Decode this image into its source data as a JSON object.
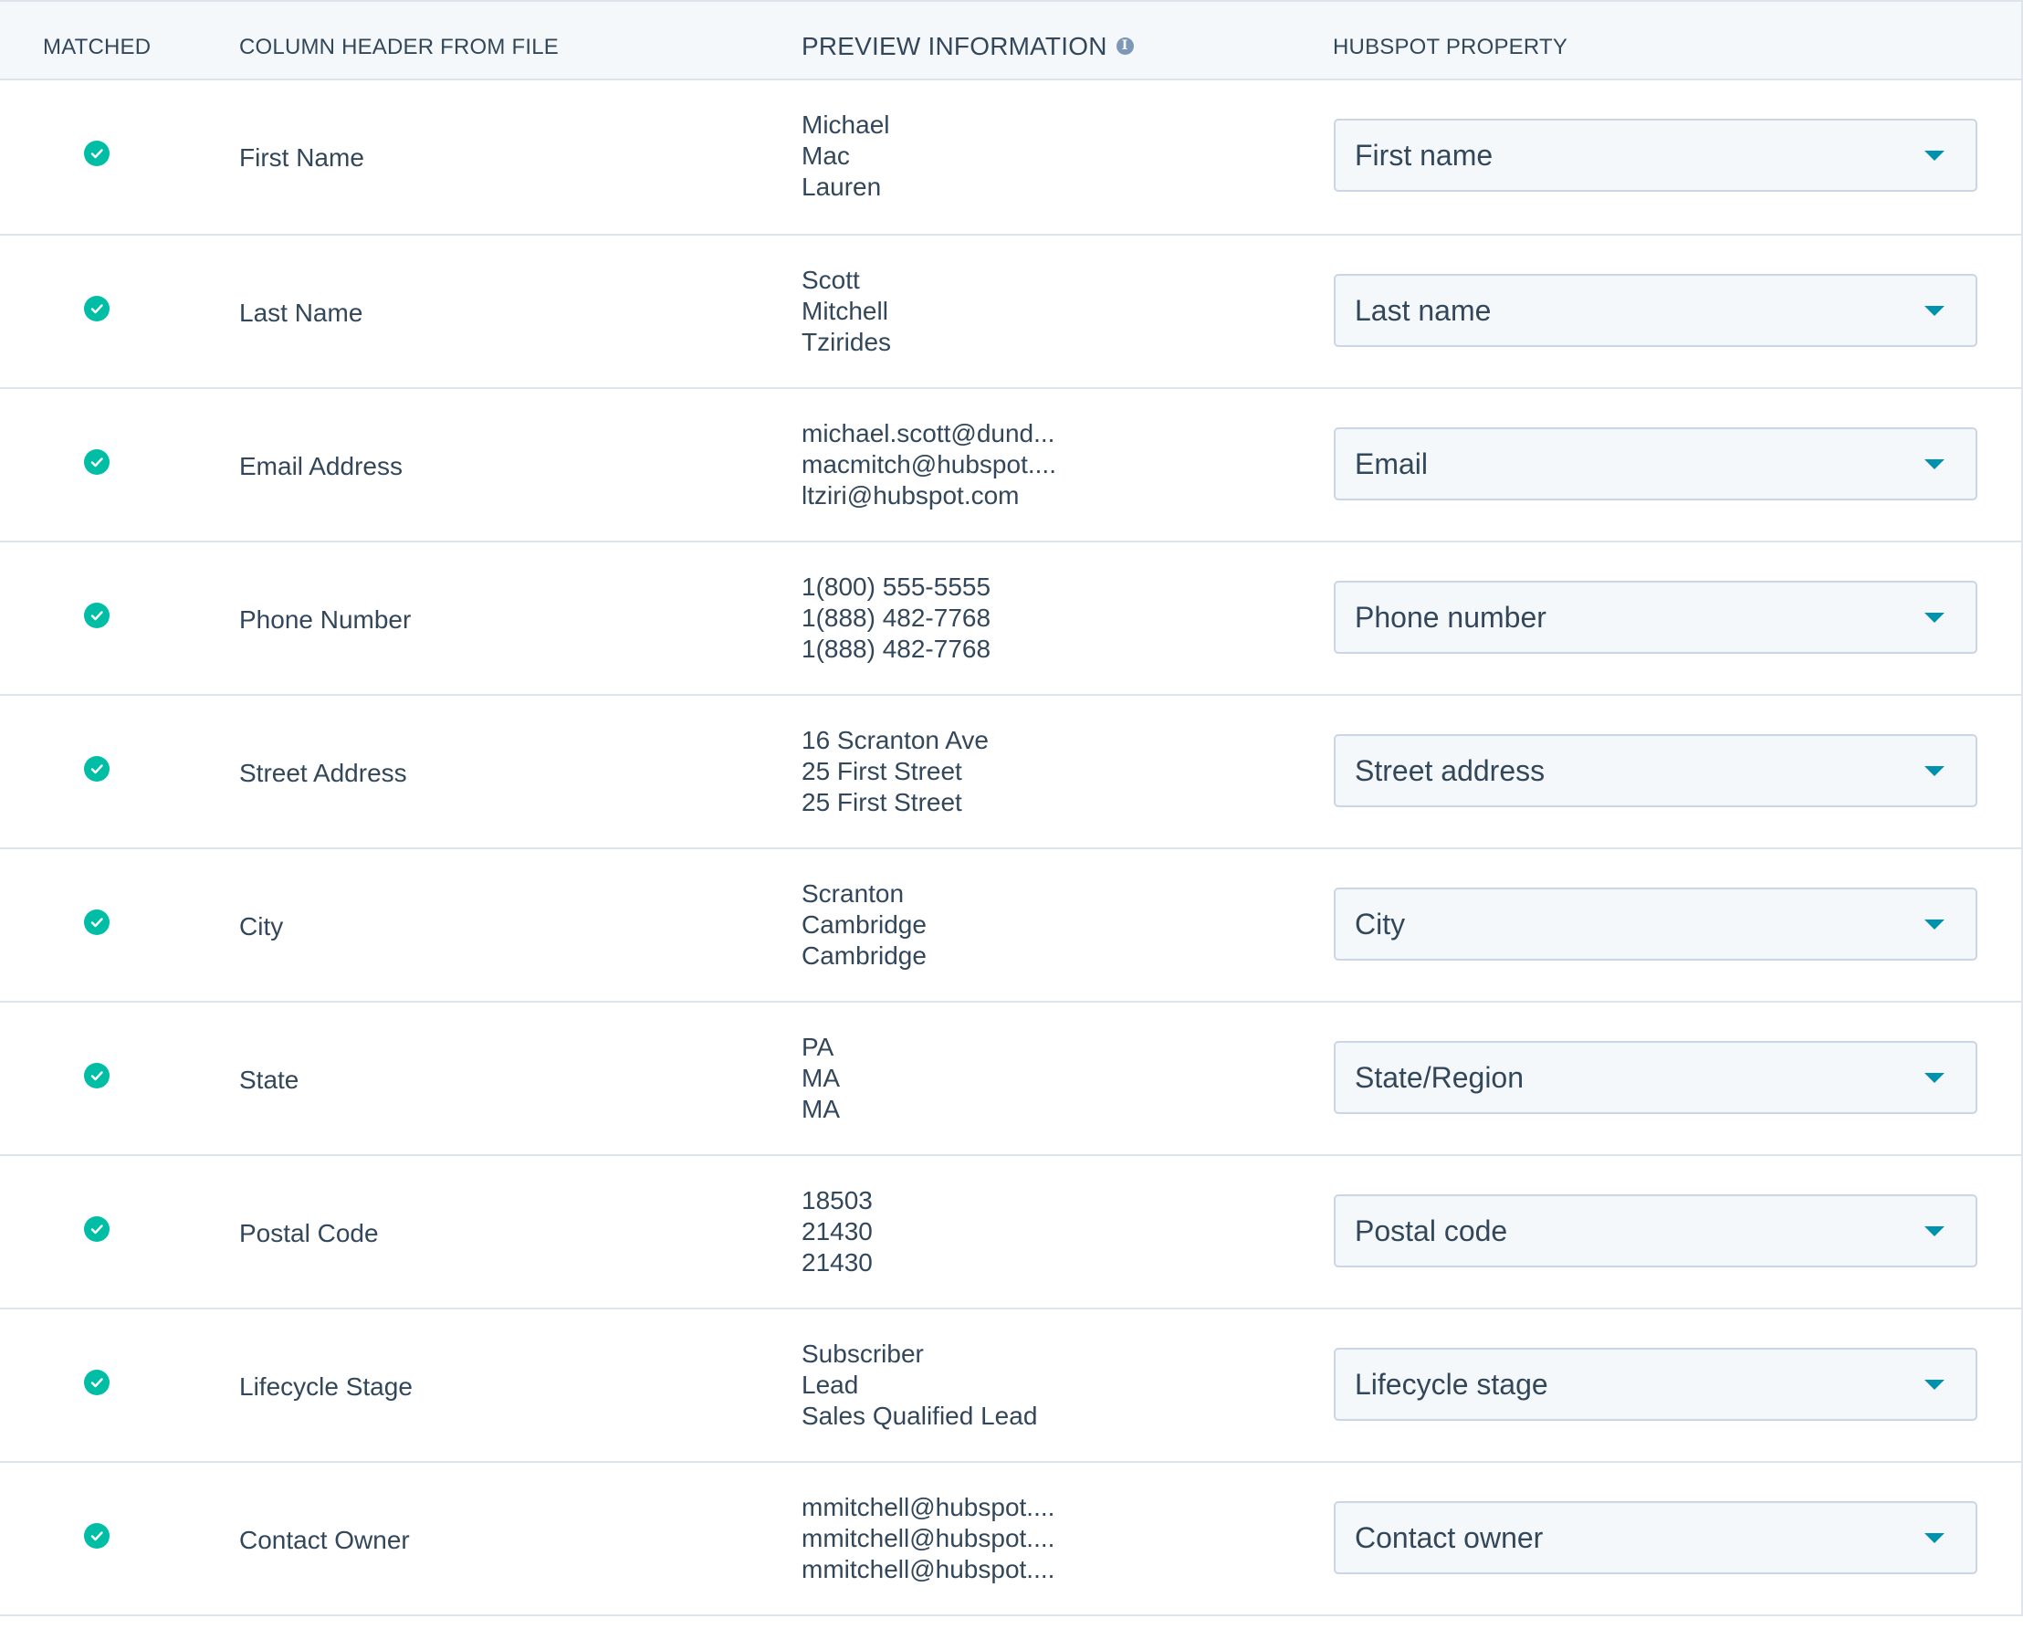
{
  "header": {
    "matched": "MATCHED",
    "column_header": "COLUMN HEADER FROM FILE",
    "preview": "PREVIEW INFORMATION",
    "preview_info_icon": "info-icon",
    "property": "HUBSPOT PROPERTY"
  },
  "colors": {
    "check": "#00bda5",
    "caret": "#0091ae",
    "header_bg": "#f5f8fa",
    "select_bg": "#f5f8fa",
    "text": "#33475b",
    "border": "#dfe3eb"
  },
  "rows": [
    {
      "matched": true,
      "column": "First Name",
      "preview": [
        "Michael",
        "Mac",
        "Lauren"
      ],
      "property": "First name"
    },
    {
      "matched": true,
      "column": "Last Name",
      "preview": [
        "Scott",
        "Mitchell",
        "Tzirides"
      ],
      "property": "Last name"
    },
    {
      "matched": true,
      "column": "Email Address",
      "preview": [
        "michael.scott@dund...",
        "macmitch@hubspot....",
        "ltziri@hubspot.com"
      ],
      "property": "Email"
    },
    {
      "matched": true,
      "column": "Phone Number",
      "preview": [
        "1(800) 555-5555",
        "1(888) 482-7768",
        "1(888) 482-7768"
      ],
      "property": "Phone number"
    },
    {
      "matched": true,
      "column": "Street Address",
      "preview": [
        "16 Scranton Ave",
        "25 First Street",
        "25 First Street"
      ],
      "property": "Street address"
    },
    {
      "matched": true,
      "column": "City",
      "preview": [
        "Scranton",
        "Cambridge",
        "Cambridge"
      ],
      "property": "City"
    },
    {
      "matched": true,
      "column": "State",
      "preview": [
        "PA",
        "MA",
        "MA"
      ],
      "property": "State/Region"
    },
    {
      "matched": true,
      "column": "Postal Code",
      "preview": [
        "18503",
        "21430",
        "21430"
      ],
      "property": "Postal code"
    },
    {
      "matched": true,
      "column": "Lifecycle Stage",
      "preview": [
        "Subscriber",
        "Lead",
        "Sales Qualified Lead"
      ],
      "property": "Lifecycle stage"
    },
    {
      "matched": true,
      "column": "Contact Owner",
      "preview": [
        "mmitchell@hubspot....",
        "mmitchell@hubspot....",
        "mmitchell@hubspot...."
      ],
      "property": "Contact owner"
    }
  ]
}
